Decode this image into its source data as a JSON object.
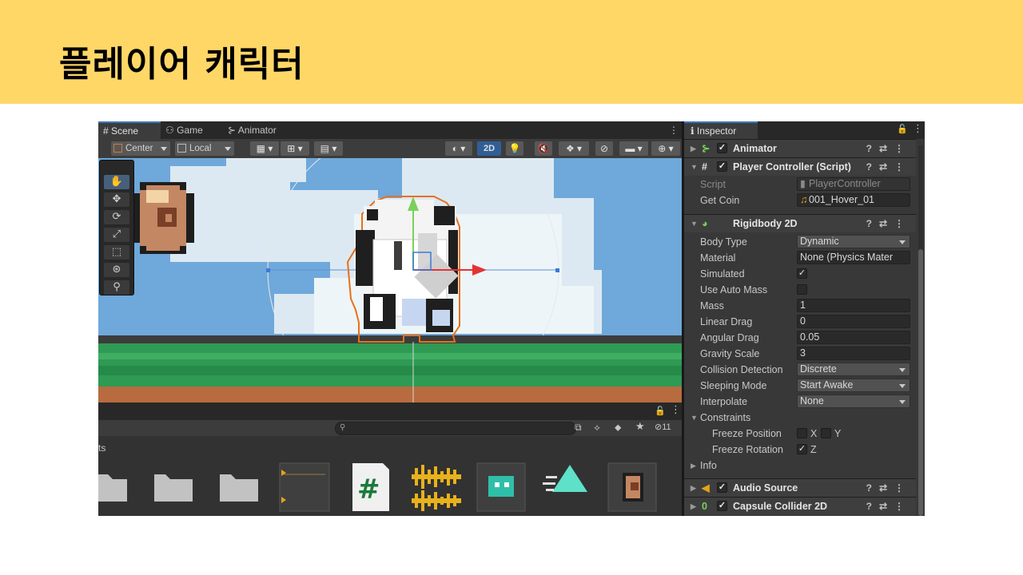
{
  "slide": {
    "title": "플레이어 캐릭터"
  },
  "scene_tabs": [
    {
      "icon": "grid-icon",
      "label": "Scene"
    },
    {
      "icon": "gamepad-icon",
      "label": "Game"
    },
    {
      "icon": "animator-icon",
      "label": "Animator"
    }
  ],
  "toolbar": {
    "pivot": "Center",
    "space": "Local",
    "mode_2d": "2D"
  },
  "tools": [
    "hand-tool",
    "move-tool",
    "rotate-tool",
    "scale-tool",
    "rect-tool",
    "transform-tool",
    "custom-tool"
  ],
  "project": {
    "breadcrumb": "ts",
    "visible_count": "11"
  },
  "assets": [
    "folder",
    "folder",
    "folder",
    "animation-clip",
    "csharp-script",
    "audio-clip",
    "sprite-character",
    "logo",
    "coin-sprite"
  ],
  "inspector": {
    "tab": "Inspector",
    "components": {
      "animator": "Animator",
      "player_controller": "Player Controller (Script)",
      "rigidbody": "Rigidbody 2D",
      "audio_source": "Audio Source",
      "capsule": "Capsule Collider 2D"
    },
    "script": {
      "label": "Script",
      "value": "PlayerController"
    },
    "get_coin": {
      "label": "Get Coin",
      "value": "001_Hover_01"
    },
    "rows": [
      {
        "label": "Body Type",
        "value": "Dynamic"
      },
      {
        "label": "Material",
        "value": "None (Physics Mater"
      },
      {
        "label": "Simulated",
        "value": "✓"
      },
      {
        "label": "Use Auto Mass",
        "value": ""
      },
      {
        "label": "Mass",
        "value": "1"
      },
      {
        "label": "Linear Drag",
        "value": "0"
      },
      {
        "label": "Angular Drag",
        "value": "0.05"
      },
      {
        "label": "Gravity Scale",
        "value": "3"
      },
      {
        "label": "Collision Detection",
        "value": "Discrete"
      },
      {
        "label": "Sleeping Mode",
        "value": "Start Awake"
      },
      {
        "label": "Interpolate",
        "value": "None"
      }
    ],
    "constraints": {
      "label": "Constraints",
      "freeze_position": "Freeze Position",
      "x": "X",
      "y": "Y",
      "freeze_rotation": "Freeze Rotation",
      "z": "Z"
    },
    "info": "Info"
  }
}
